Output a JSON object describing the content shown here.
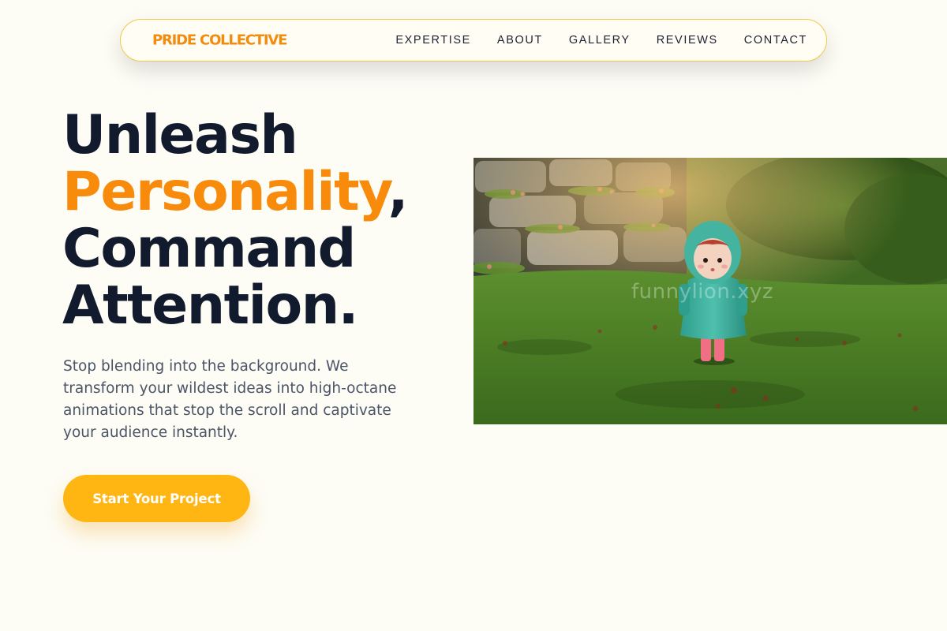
{
  "nav": {
    "brand": "PRIDE COLLECTIVE",
    "links": [
      "EXPERTISE",
      "ABOUT",
      "GALLERY",
      "REVIEWS",
      "CONTACT"
    ]
  },
  "hero": {
    "headline": {
      "line1": "Unleash",
      "line2_accent": "Personality",
      "line2_punct": ",",
      "line3": "Command",
      "line4": "Attention."
    },
    "subtitle": "Stop blending into the background. We transform your wildest ideas into high-octane animations that stop the scroll and captivate your audience instantly.",
    "cta_label": "Start Your Project"
  },
  "image": {
    "watermark": "funnylion.xyz"
  },
  "colors": {
    "background": "#fdfcf5",
    "accent_orange": "#f98b0c",
    "button_yellow": "#ffb612",
    "nav_border": "#f2c94c",
    "heading_dark": "#121a2e"
  }
}
